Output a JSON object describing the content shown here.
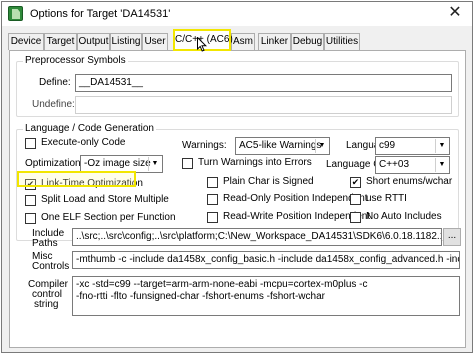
{
  "window": {
    "title": "Options for Target 'DA14531'",
    "close_symbol": "✕"
  },
  "tabs": [
    {
      "label": "Device"
    },
    {
      "label": "Target"
    },
    {
      "label": "Output"
    },
    {
      "label": "Listing"
    },
    {
      "label": "User"
    },
    {
      "label": "C/C++ (AC6)"
    },
    {
      "label": "Asm"
    },
    {
      "label": "Linker"
    },
    {
      "label": "Debug"
    },
    {
      "label": "Utilities"
    }
  ],
  "preprocessor": {
    "group_title": "Preprocessor Symbols",
    "define_label": "Define:",
    "define_value": "__DA14531__",
    "undefine_label": "Undefine:",
    "undefine_value": ""
  },
  "language": {
    "group_title": "Language / Code Generation",
    "execute_only": "Execute-only Code",
    "optimization_label": "Optimization:",
    "optimization_value": "-Oz image size",
    "lto": "Link-Time Optimization",
    "split_load": "Split Load and Store Multiple",
    "one_elf": "One ELF Section per Function",
    "warnings_label": "Warnings:",
    "warnings_value": "AC5-like Warnings",
    "turn_warnings": "Turn Warnings into Errors",
    "plain_char": "Plain Char is Signed",
    "ropi": "Read-Only Position Independent",
    "rwpi": "Read-Write Position Independent",
    "lang_c_label": "Language C:",
    "lang_c_value": "c99",
    "lang_cpp_label": "Language C++:",
    "lang_cpp_value": "C++03",
    "short_enums": "Short enums/wchar",
    "use_rtti": "use RTTI",
    "no_auto_includes": "No Auto Includes"
  },
  "include_paths": {
    "label_line1": "Include",
    "label_line2": "Paths",
    "value": "..\\src;..\\src\\config;..\\src\\platform;C:\\New_Workspace_DA14531\\SDK6\\6.0.18.1182.1\\sdk;C:\\New_",
    "browse": "..."
  },
  "misc_controls": {
    "label_line1": "Misc",
    "label_line2": "Controls",
    "value": "-mthumb -c -include da1458x_config_basic.h -include da1458x_config_advanced.h -include user_config.h"
  },
  "compiler_string": {
    "label_line1": "Compiler",
    "label_line2": "control",
    "label_line3": "string",
    "line1": "-xc -std=c99 --target=arm-arm-none-eabi -mcpu=cortex-m0plus -c",
    "line2": "-fno-rtti -flto -funsigned-char -fshort-enums -fshort-wchar"
  },
  "colors": {
    "highlight": "#f2e600",
    "active_tab_border": "#2b7fd6"
  }
}
